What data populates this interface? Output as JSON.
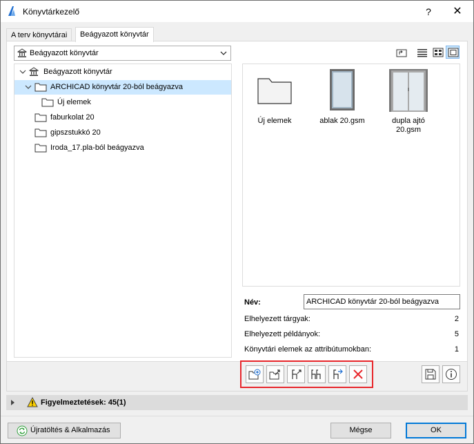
{
  "window": {
    "title": "Könyvtárkezelő",
    "help_glyph": "?",
    "close_glyph": "✕"
  },
  "tabs": [
    {
      "label": "A terv könyvtárai",
      "active": false
    },
    {
      "label": "Beágyazott könyvtár",
      "active": true
    }
  ],
  "combo": {
    "value": "Beágyazott könyvtár"
  },
  "tree": {
    "root": "Beágyazott könyvtár",
    "items": [
      {
        "label": "ARCHICAD könyvtár 20-ból beágyazva",
        "selected": true
      },
      {
        "label": "Új elemek"
      },
      {
        "label": "faburkolat 20"
      },
      {
        "label": "gipszstukkó 20"
      },
      {
        "label": "Iroda_17.pla-ból beágyazva"
      }
    ]
  },
  "view_toolbar": {
    "icons": [
      "up-folder-icon",
      "list-view-icon",
      "grid-view-icon",
      "preview-view-icon"
    ],
    "active": "preview-view-icon"
  },
  "preview": {
    "items": [
      {
        "label": "Új elemek",
        "icon": "folder-icon"
      },
      {
        "label": "ablak 20.gsm",
        "icon": "window-icon"
      },
      {
        "label": "dupla ajtó 20.gsm",
        "icon": "double-door-icon"
      }
    ]
  },
  "info": {
    "name_label": "Név:",
    "name_value": "ARCHICAD könyvtár 20-ból beágyazva",
    "rows": [
      {
        "label": "Elhelyezett tárgyak:",
        "value": "2"
      },
      {
        "label": "Elhelyezett példányok:",
        "value": "5"
      },
      {
        "label": "Könyvtári elemek az attribútumokban:",
        "value": "1"
      }
    ]
  },
  "actions": {
    "buttons": [
      "new-folder-icon",
      "import-folder-icon",
      "import-object-icon",
      "copy-objects-icon",
      "move-object-icon",
      "delete-icon"
    ],
    "right_buttons": [
      "save-library-icon",
      "info-icon"
    ]
  },
  "warnings": {
    "label": "Figyelmeztetések: 45(1)"
  },
  "footer": {
    "reload_label": "Újratöltés & Alkalmazás",
    "cancel_label": "Mégse",
    "ok_label": "OK"
  },
  "colors": {
    "selection": "#cce8ff",
    "highlight_box": "#e8262b",
    "default_button": "#0078d7"
  }
}
